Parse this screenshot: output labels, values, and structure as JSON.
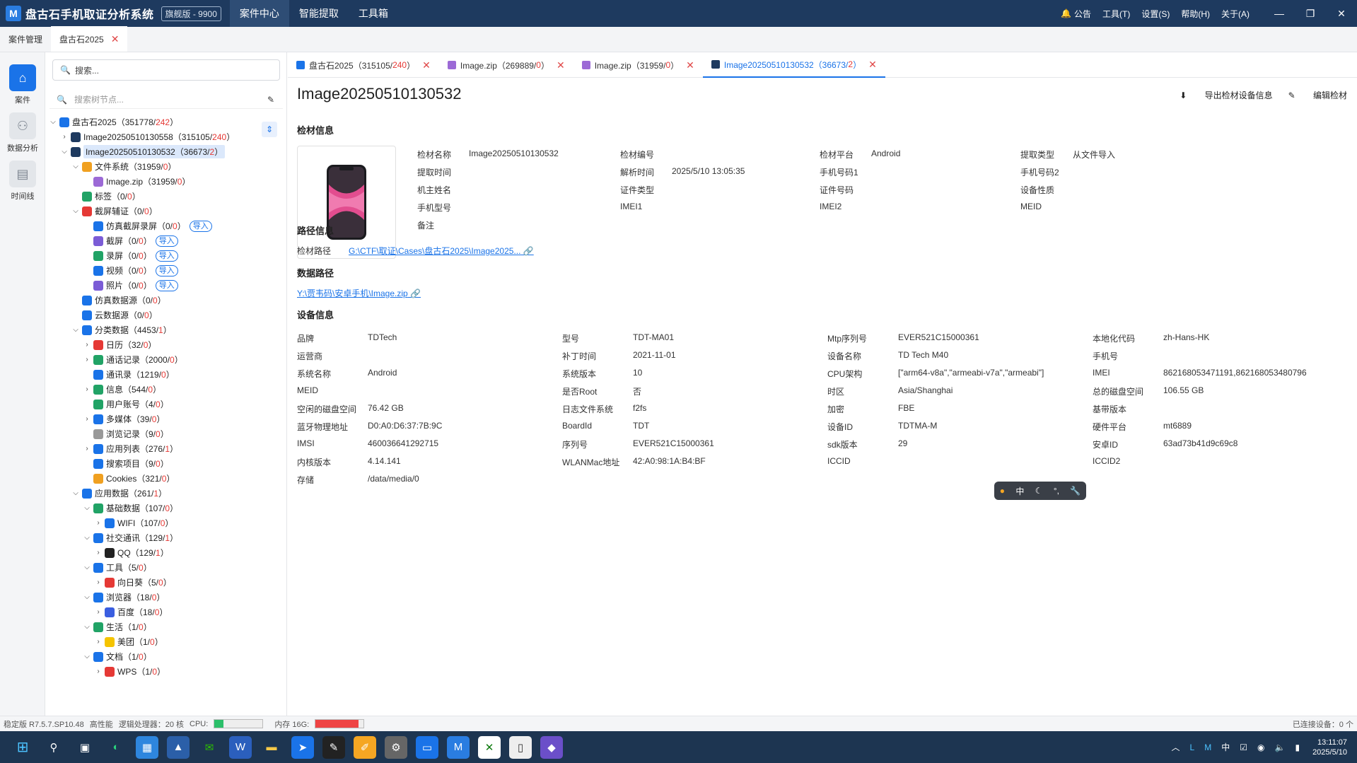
{
  "app": {
    "logo": "M",
    "title": "盘古石手机取证分析系统",
    "edition": "旗舰版 - 9900"
  },
  "topnav": [
    "案件中心",
    "智能提取",
    "工具箱"
  ],
  "rightmenu": {
    "notice": "公告",
    "tools": "工具(T)",
    "settings": "设置(S)",
    "help": "帮助(H)",
    "about": "关于(A)"
  },
  "window": {
    "minimize": "—",
    "restore": "❐",
    "close": "✕"
  },
  "tabs1": [
    {
      "label": "案件管理"
    },
    {
      "label": "盘古石2025"
    }
  ],
  "rail": [
    {
      "label": "案件",
      "icon": "home-icon"
    },
    {
      "label": "数据分析",
      "icon": "analysis-icon"
    },
    {
      "label": "时间线",
      "icon": "timeline-icon"
    }
  ],
  "search": {
    "placeholder": "搜索...",
    "tree_placeholder": "搜索树节点..."
  },
  "tree": [
    {
      "l": 0,
      "a": "v",
      "c": "#1a73e8",
      "t": "盘古石2025（351778/",
      "r": "242",
      "e": "）"
    },
    {
      "l": 1,
      "a": ">",
      "c": "#1e3a5f",
      "t": "Image20250510130558（315105/",
      "r": "240",
      "e": "）"
    },
    {
      "l": 1,
      "a": "v",
      "c": "#1e3a5f",
      "t": "Image20250510130532（36673/",
      "r": "2",
      "e": "）",
      "sel": true
    },
    {
      "l": 2,
      "a": "v",
      "c": "#f0a020",
      "t": "文件系统（31959/",
      "r": "0",
      "e": "）"
    },
    {
      "l": 3,
      "a": "",
      "c": "#9c6ad6",
      "t": "Image.zip（31959/",
      "r": "0",
      "e": "）"
    },
    {
      "l": 2,
      "a": "",
      "c": "#21a366",
      "t": "标签（0/",
      "r": "0",
      "e": "）"
    },
    {
      "l": 2,
      "a": "v",
      "c": "#e53935",
      "t": "截屏辅证（0/",
      "r": "0",
      "e": "）"
    },
    {
      "l": 3,
      "a": "",
      "c": "#1a73e8",
      "t": "仿真截屏录屏（0/",
      "r": "0",
      "e": "）",
      "imp": true
    },
    {
      "l": 3,
      "a": "",
      "c": "#7b5cd6",
      "t": "截屏（0/",
      "r": "0",
      "e": "）",
      "imp": true
    },
    {
      "l": 3,
      "a": "",
      "c": "#21a366",
      "t": "录屏（0/",
      "r": "0",
      "e": "）",
      "imp": true
    },
    {
      "l": 3,
      "a": "",
      "c": "#1a73e8",
      "t": "视频（0/",
      "r": "0",
      "e": "）",
      "imp": true
    },
    {
      "l": 3,
      "a": "",
      "c": "#7b5cd6",
      "t": "照片（0/",
      "r": "0",
      "e": "）",
      "imp": true
    },
    {
      "l": 2,
      "a": "",
      "c": "#1a73e8",
      "t": "仿真数据源（0/",
      "r": "0",
      "e": "）"
    },
    {
      "l": 2,
      "a": "",
      "c": "#1a73e8",
      "t": "云数据源（0/",
      "r": "0",
      "e": "）"
    },
    {
      "l": 2,
      "a": "v",
      "c": "#1a73e8",
      "t": "分类数据（4453/",
      "r": "1",
      "e": "）"
    },
    {
      "l": 3,
      "a": ">",
      "c": "#e53935",
      "t": "日历（32/",
      "r": "0",
      "e": "）"
    },
    {
      "l": 3,
      "a": ">",
      "c": "#21a366",
      "t": "通话记录（2000/",
      "r": "0",
      "e": "）"
    },
    {
      "l": 3,
      "a": "",
      "c": "#1a73e8",
      "t": "通讯录（1219/",
      "r": "0",
      "e": "）"
    },
    {
      "l": 3,
      "a": ">",
      "c": "#21a366",
      "t": "信息（544/",
      "r": "0",
      "e": "）"
    },
    {
      "l": 3,
      "a": "",
      "c": "#21a366",
      "t": "用户账号（4/",
      "r": "0",
      "e": "）"
    },
    {
      "l": 3,
      "a": ">",
      "c": "#1a73e8",
      "t": "多媒体（39/",
      "r": "0",
      "e": "）"
    },
    {
      "l": 3,
      "a": "",
      "c": "#999999",
      "t": "浏览记录（9/",
      "r": "0",
      "e": "）"
    },
    {
      "l": 3,
      "a": ">",
      "c": "#1a73e8",
      "t": "应用列表（276/",
      "r": "1",
      "e": "）"
    },
    {
      "l": 3,
      "a": "",
      "c": "#1a73e8",
      "t": "搜索项目（9/",
      "r": "0",
      "e": "）"
    },
    {
      "l": 3,
      "a": "",
      "c": "#f0a020",
      "t": "Cookies（321/",
      "r": "0",
      "e": "）"
    },
    {
      "l": 2,
      "a": "v",
      "c": "#1a73e8",
      "t": "应用数据（261/",
      "r": "1",
      "e": "）"
    },
    {
      "l": 3,
      "a": "v",
      "c": "#21a366",
      "t": "基础数据（107/",
      "r": "0",
      "e": "）"
    },
    {
      "l": 4,
      "a": ">",
      "c": "#1a73e8",
      "t": "WIFI（107/",
      "r": "0",
      "e": "）"
    },
    {
      "l": 3,
      "a": "v",
      "c": "#1a73e8",
      "t": "社交通讯（129/",
      "r": "1",
      "e": "）"
    },
    {
      "l": 4,
      "a": ">",
      "c": "#222222",
      "t": "QQ（129/",
      "r": "1",
      "e": "）"
    },
    {
      "l": 3,
      "a": "v",
      "c": "#1a73e8",
      "t": "工具（5/",
      "r": "0",
      "e": "）"
    },
    {
      "l": 4,
      "a": ">",
      "c": "#e53935",
      "t": "向日葵（5/",
      "r": "0",
      "e": "）"
    },
    {
      "l": 3,
      "a": "v",
      "c": "#1a73e8",
      "t": "浏览器（18/",
      "r": "0",
      "e": "）"
    },
    {
      "l": 4,
      "a": ">",
      "c": "#3a5ee0",
      "t": "百度（18/",
      "r": "0",
      "e": "）"
    },
    {
      "l": 3,
      "a": "v",
      "c": "#21a366",
      "t": "生活（1/",
      "r": "0",
      "e": "）"
    },
    {
      "l": 4,
      "a": ">",
      "c": "#f5c400",
      "t": "美团（1/",
      "r": "0",
      "e": "）"
    },
    {
      "l": 3,
      "a": "v",
      "c": "#1a73e8",
      "t": "文档（1/",
      "r": "0",
      "e": "）"
    },
    {
      "l": 4,
      "a": ">",
      "c": "#e53935",
      "t": "WPS（1/",
      "r": "0",
      "e": "）"
    }
  ],
  "import_label": "导入",
  "tabs2": [
    {
      "label": "盘古石2025（315105/",
      "red": "240",
      "end": "）",
      "color": "#1a73e8"
    },
    {
      "label": "Image.zip（269889/",
      "red": "0",
      "end": "）",
      "color": "#9c6ad6"
    },
    {
      "label": "Image.zip（31959/",
      "red": "0",
      "end": "）",
      "color": "#9c6ad6"
    },
    {
      "label": "Image20250510130532（36673/",
      "red": "2",
      "end": "）",
      "color": "#1e3a5f",
      "active": true
    }
  ],
  "page": {
    "title": "Image20250510130532",
    "export": "导出检材设备信息",
    "edit": "编辑检材"
  },
  "sections": {
    "material": "检材信息",
    "path": "路径信息",
    "datapath": "数据路径",
    "device": "设备信息"
  },
  "material": [
    [
      "检材名称",
      "Image20250510130532"
    ],
    [
      "检材编号",
      ""
    ],
    [
      "检材平台",
      "Android"
    ],
    [
      "提取类型",
      "从文件导入"
    ],
    [
      "提取时间",
      ""
    ],
    [
      "解析时间",
      "2025/5/10 13:05:35"
    ],
    [
      "手机号码1",
      ""
    ],
    [
      "手机号码2",
      ""
    ],
    [
      "机主姓名",
      ""
    ],
    [
      "证件类型",
      ""
    ],
    [
      "证件号码",
      ""
    ],
    [
      "设备性质",
      ""
    ],
    [
      "手机型号",
      ""
    ],
    [
      "IMEI1",
      ""
    ],
    [
      "IMEI2",
      ""
    ],
    [
      "MEID",
      ""
    ],
    [
      "备注",
      ""
    ]
  ],
  "path": {
    "label": "检材路径",
    "value": "G:\\CTF\\取证\\Cases\\盘古石2025\\Image2025..."
  },
  "datapath": "Y:\\贾韦码\\安卓手机\\Image.zip",
  "device": [
    [
      "品牌",
      "TDTech"
    ],
    [
      "型号",
      "TDT-MA01"
    ],
    [
      "Mtp序列号",
      "EVER521C15000361"
    ],
    [
      "本地化代码",
      "zh-Hans-HK"
    ],
    [
      "运营商",
      ""
    ],
    [
      "补丁时间",
      "2021-11-01"
    ],
    [
      "设备名称",
      "TD Tech M40"
    ],
    [
      "手机号",
      ""
    ],
    [
      "系统名称",
      "Android"
    ],
    [
      "系统版本",
      "10"
    ],
    [
      "CPU架构",
      "[\"arm64-v8a\",\"armeabi-v7a\",\"armeabi\"]"
    ],
    [
      "IMEI",
      "862168053471191,862168053480796"
    ],
    [
      "MEID",
      ""
    ],
    [
      "是否Root",
      "否"
    ],
    [
      "时区",
      "Asia/Shanghai"
    ],
    [
      "总的磁盘空间",
      "106.55 GB"
    ],
    [
      "空闲的磁盘空间",
      "76.42 GB"
    ],
    [
      "日志文件系统",
      "f2fs"
    ],
    [
      "加密",
      "FBE"
    ],
    [
      "基带版本",
      ""
    ],
    [
      "蓝牙物理地址",
      "D0:A0:D6:37:7B:9C"
    ],
    [
      "BoardId",
      "TDT"
    ],
    [
      "设备ID",
      "TDTMA-M"
    ],
    [
      "硬件平台",
      "mt6889"
    ],
    [
      "IMSI",
      "460036641292715"
    ],
    [
      "序列号",
      "EVER521C15000361"
    ],
    [
      "sdk版本",
      "29"
    ],
    [
      "安卓ID",
      "63ad73b41d9c69c8"
    ],
    [
      "内核版本",
      "4.14.141"
    ],
    [
      "WLANMac地址",
      "42:A0:98:1A:B4:BF"
    ],
    [
      "ICCID",
      ""
    ],
    [
      "ICCID2",
      ""
    ],
    [
      "存储",
      "/data/media/0"
    ]
  ],
  "float": {
    "lang": "中"
  },
  "status": {
    "version": "稳定版 R7.5.7.SP10.48",
    "perf": "高性能",
    "cpu_cores": "逻辑处理器：20 核",
    "cpu": "CPU:",
    "cpu_pct": 0.18,
    "mem": "内存 16G:",
    "mem_pct": 0.9,
    "devices": "已连接设备：0 个"
  },
  "taskbar": {
    "ime": "中",
    "time": "13:11:07",
    "date": "2025/5/10"
  },
  "colors": {
    "titlebar": "#1e3a5f",
    "accent": "#1a73e8",
    "red": "#e53935",
    "cpu": "#2bbf6a",
    "mem": "#ef4444"
  }
}
